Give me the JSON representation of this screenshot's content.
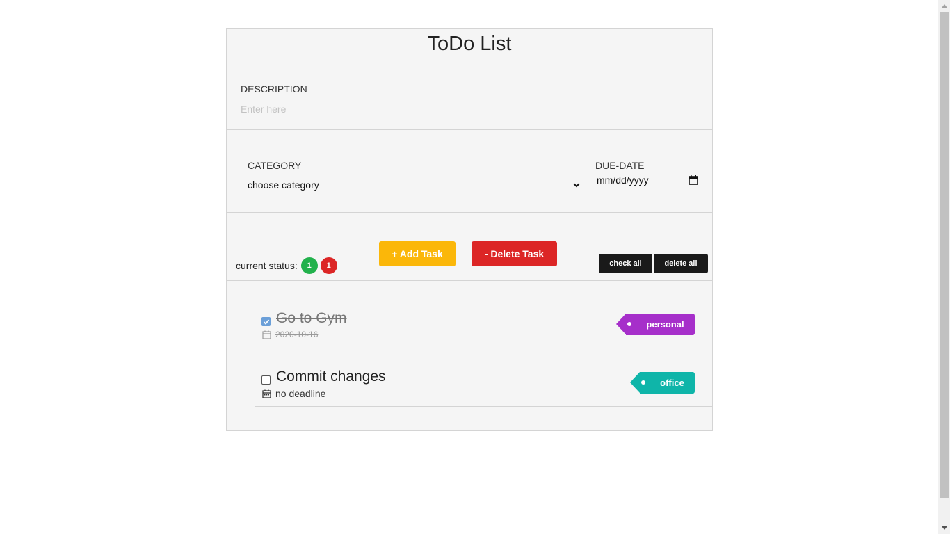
{
  "app": {
    "title": "ToDo List"
  },
  "description": {
    "label": "DESCRIPTION",
    "placeholder": "Enter here",
    "value": ""
  },
  "category": {
    "label": "CATEGORY",
    "selected": "choose category"
  },
  "due_date": {
    "label": "DUE-DATE",
    "placeholder": "mm/dd/yyyy"
  },
  "status": {
    "label": "current status:",
    "completed_count": "1",
    "pending_count": "1",
    "completed_color": "#22b14c",
    "pending_color": "#dc2626"
  },
  "buttons": {
    "add": "+ Add Task",
    "delete": "- Delete Task",
    "check_all": "check all",
    "delete_all": "delete all"
  },
  "tasks": [
    {
      "name": "Go to Gym",
      "date": "2020-10-16",
      "category": "personal",
      "done": true,
      "color": "#a62fca"
    },
    {
      "name": "Commit changes",
      "date": "no deadline",
      "category": "office",
      "done": false,
      "color": "#0fb5a9"
    }
  ],
  "icons": {
    "calendar": "calendar-icon",
    "chevron": "chevron-down-icon",
    "check": "check-icon"
  }
}
